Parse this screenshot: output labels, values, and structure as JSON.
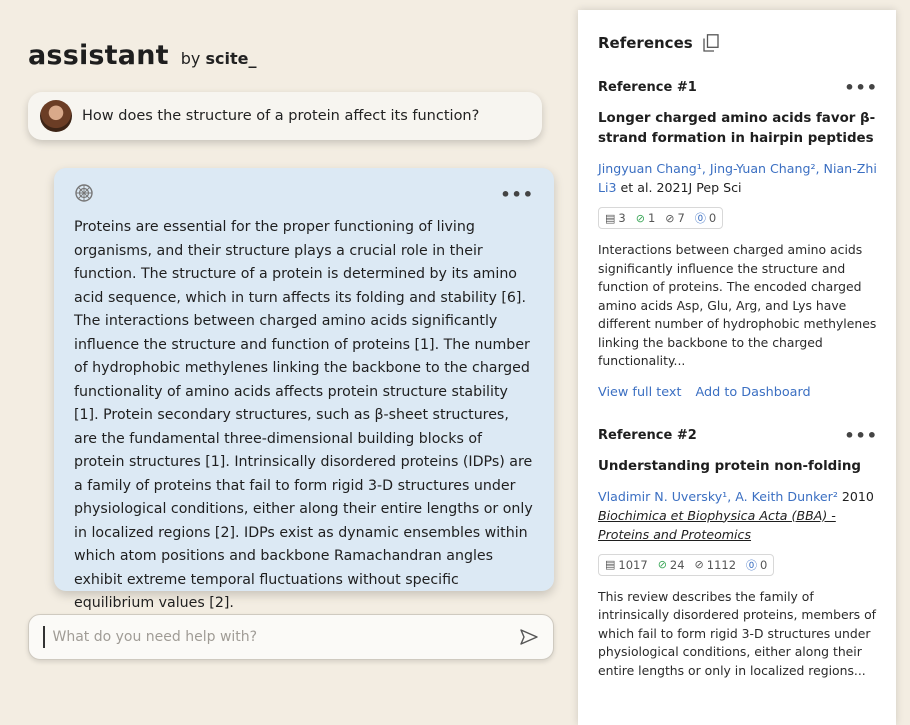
{
  "brand": {
    "title": "assistant",
    "by": "by",
    "company": "scite_"
  },
  "conversation": {
    "user_message": "How does the structure of a protein affect its function?",
    "assistant_answer": "Proteins are essential for the proper functioning of living organisms, and their structure plays a crucial role in their function. The structure of a protein is determined by its amino acid sequence, which in turn affects its folding and stability [6]. The interactions between charged amino acids significantly influence the structure and function of proteins [1]. The number of hydrophobic methylenes linking the backbone to the charged functionality of amino acids affects protein structure stability [1]. Protein secondary structures, such as β-sheet structures, are the fundamental three-dimensional building blocks of protein structures [1]. Intrinsically disordered proteins (IDPs) are a family of proteins that fail to form rigid 3-D structures under physiological conditions, either along their entire lengths or only in localized regions [2]. IDPs exist as dynamic ensembles within which atom positions and backbone Ramachandran angles exhibit extreme temporal fluctuations without specific equilibrium values [2].",
    "more_label": "•••"
  },
  "input": {
    "placeholder": "What do you need help with?"
  },
  "references": {
    "title": "References",
    "items": [
      {
        "number": "Reference #1",
        "more": "•••",
        "title": "Longer charged amino acids favor β-strand formation in hairpin peptides",
        "authors": "Jingyuan Chang¹, Jing-Yuan Chang², Nian-Zhi Li3",
        "meta": " et al. 2021J Pep Sci",
        "stats": {
          "cites": "3",
          "supporting": "1",
          "mentioning": "7",
          "contrasting": "0"
        },
        "description": "Interactions between charged amino acids significantly influence the structure and function of proteins. The encoded charged amino acids Asp, Glu, Arg, and Lys have different number of hydrophobic methylenes linking the backbone to the charged functionality...",
        "action_full_text": "View full text",
        "action_dashboard": "Add to Dashboard"
      },
      {
        "number": "Reference #2",
        "more": "•••",
        "title": "Understanding protein non-folding",
        "authors": "Vladimir N. Uversky¹, A. Keith Dunker²",
        "meta": " 2010",
        "journal": "Biochimica et Biophysica Acta (BBA) - Proteins and Proteomics",
        "stats": {
          "cites": "1017",
          "supporting": "24",
          "mentioning": "1112",
          "contrasting": "0"
        },
        "description": "This review describes the family of intrinsically disordered proteins, members of which fail to form rigid 3-D structures under physiological conditions, either along their entire lengths or only in localized regions..."
      }
    ]
  },
  "colors": {
    "accent": "#3b6fc2",
    "answer_bg": "#dce9f4",
    "page_bg": "#f3ede2",
    "supporting": "#3aa657"
  }
}
